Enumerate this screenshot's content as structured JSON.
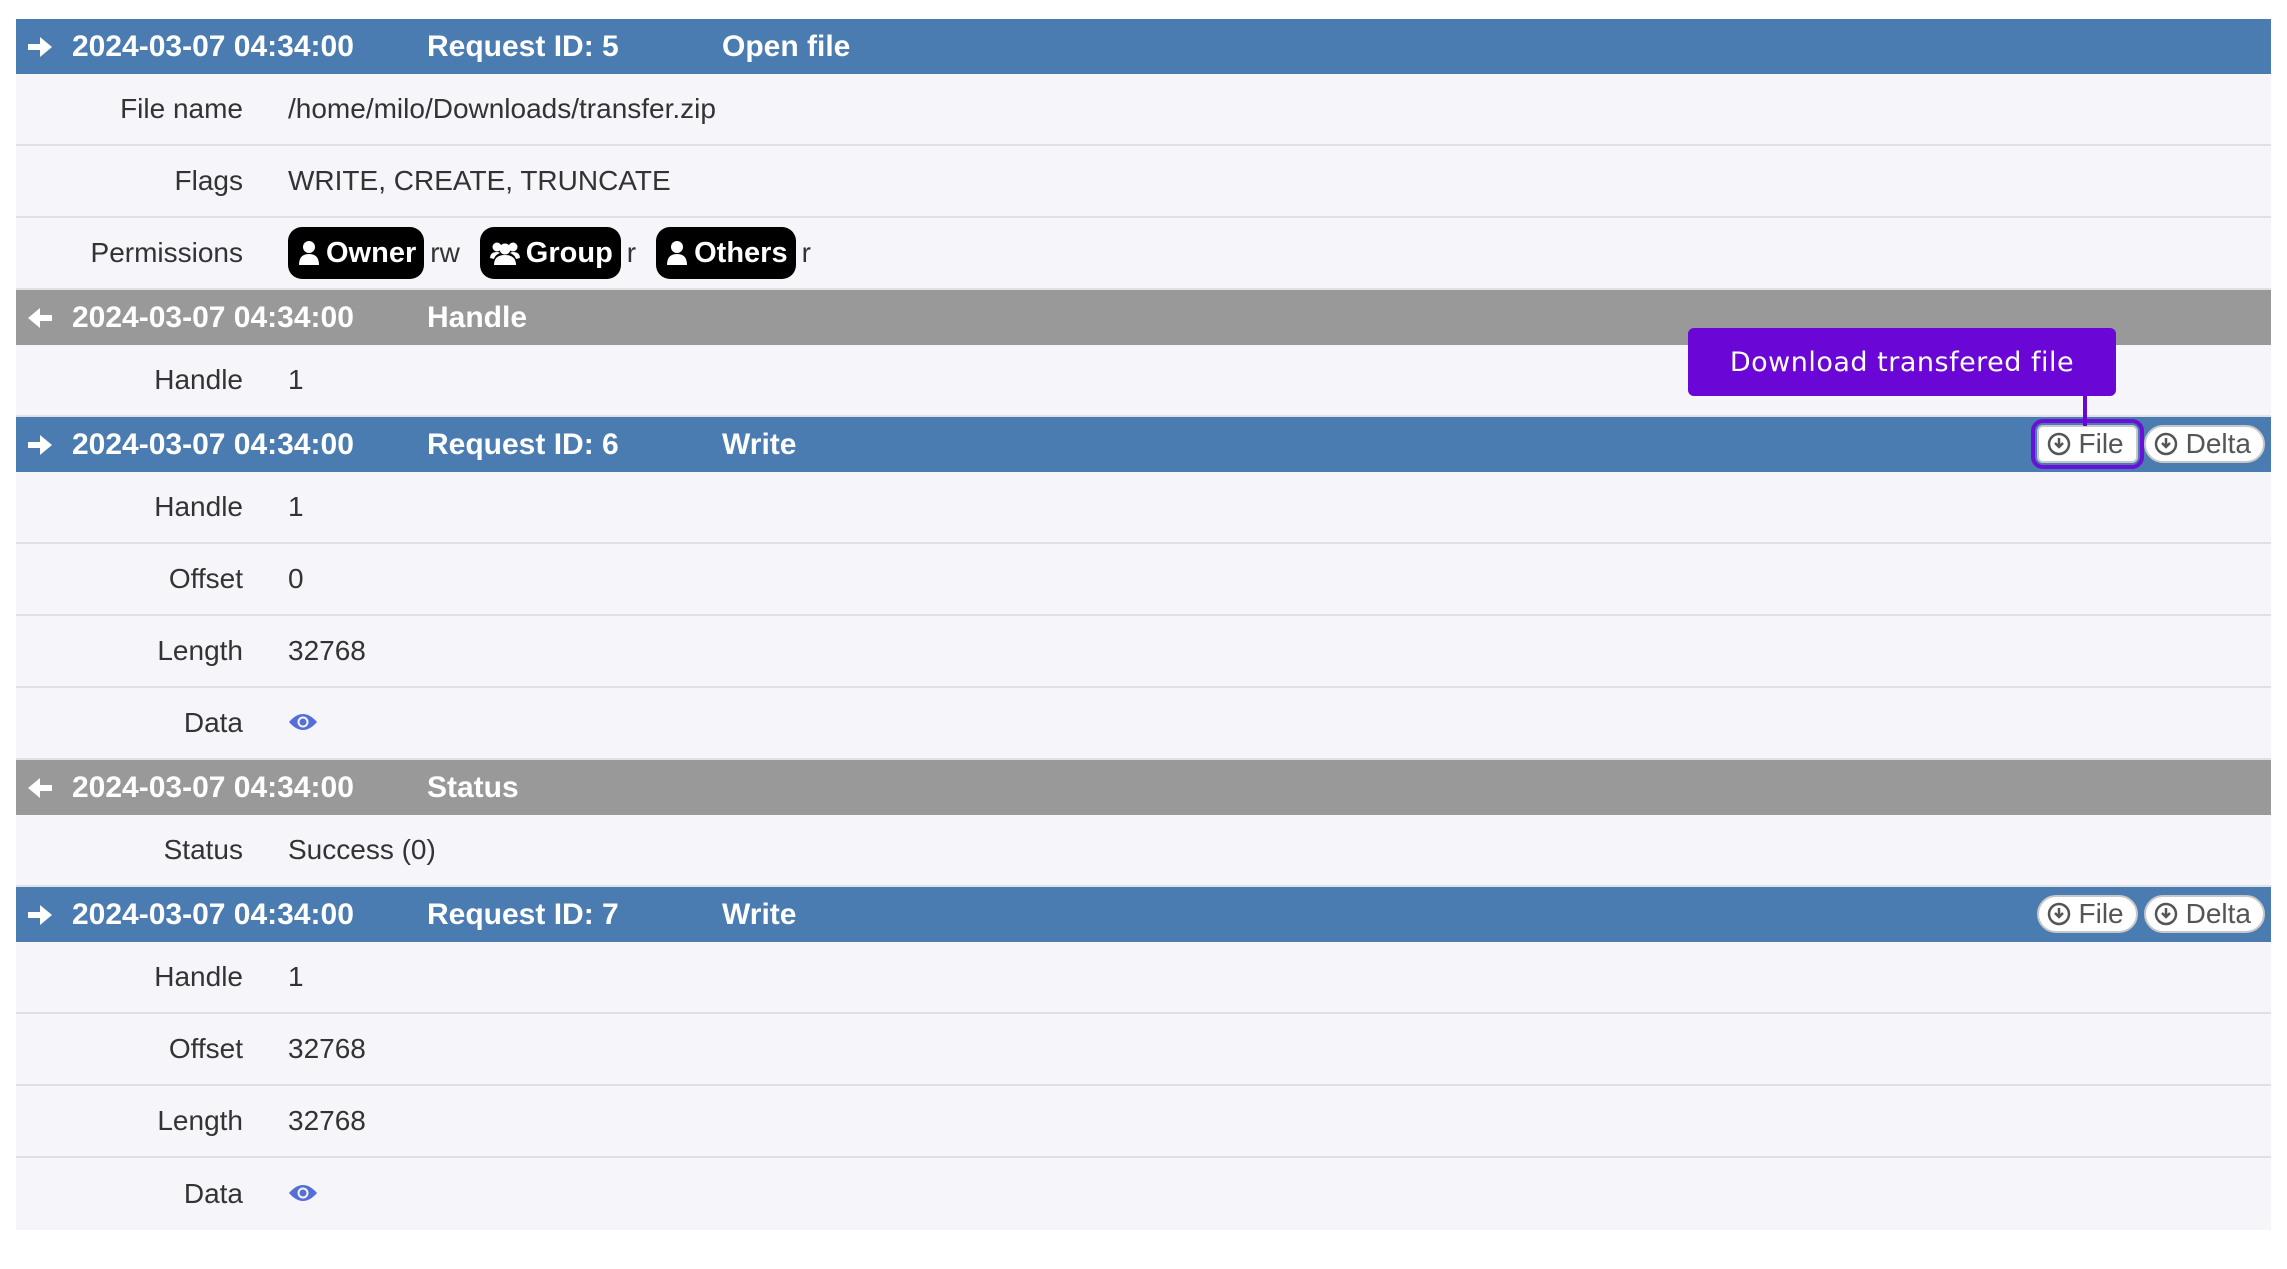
{
  "colors": {
    "request_bar": "#4a7bb1",
    "response_bar": "#999999",
    "tooltip": "#6a06d6",
    "eye_icon": "#5470d8"
  },
  "tooltip": {
    "text": "Download transfered file"
  },
  "entries": [
    {
      "direction": "request",
      "timestamp": "2024-03-07 04:34:00",
      "request_id": "Request ID: 5",
      "operation": "Open file",
      "fields": [
        {
          "label": "File name",
          "value": "/home/milo/Downloads/transfer.zip"
        },
        {
          "label": "Flags",
          "value": "WRITE, CREATE, TRUNCATE"
        },
        {
          "label": "Permissions",
          "permissions": [
            {
              "who": "Owner",
              "mode": "rw",
              "icon": "user-icon"
            },
            {
              "who": "Group",
              "mode": "r",
              "icon": "users-icon"
            },
            {
              "who": "Others",
              "mode": "r",
              "icon": "user-icon"
            }
          ]
        }
      ]
    },
    {
      "direction": "response",
      "timestamp": "2024-03-07 04:34:00",
      "operation": "Handle",
      "fields": [
        {
          "label": "Handle",
          "value": "1"
        }
      ]
    },
    {
      "direction": "request",
      "timestamp": "2024-03-07 04:34:00",
      "request_id": "Request ID: 6",
      "operation": "Write",
      "buttons": {
        "file": "File",
        "delta": "Delta"
      },
      "fields": [
        {
          "label": "Handle",
          "value": "1"
        },
        {
          "label": "Offset",
          "value": "0"
        },
        {
          "label": "Length",
          "value": "32768"
        },
        {
          "label": "Data",
          "icon": "eye-icon"
        }
      ]
    },
    {
      "direction": "response",
      "timestamp": "2024-03-07 04:34:00",
      "operation": "Status",
      "fields": [
        {
          "label": "Status",
          "value": "Success (0)"
        }
      ]
    },
    {
      "direction": "request",
      "timestamp": "2024-03-07 04:34:00",
      "request_id": "Request ID: 7",
      "operation": "Write",
      "buttons": {
        "file": "File",
        "delta": "Delta"
      },
      "fields": [
        {
          "label": "Handle",
          "value": "1"
        },
        {
          "label": "Offset",
          "value": "32768"
        },
        {
          "label": "Length",
          "value": "32768"
        },
        {
          "label": "Data",
          "icon": "eye-icon"
        }
      ]
    }
  ]
}
